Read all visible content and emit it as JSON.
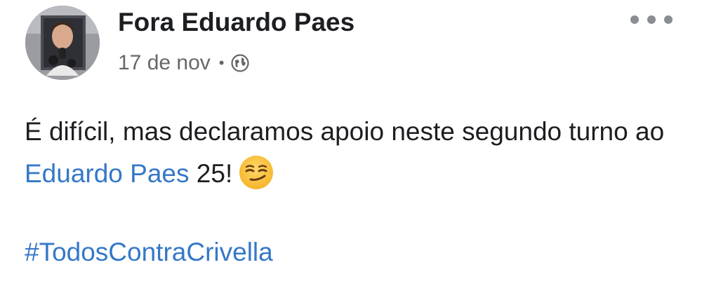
{
  "post": {
    "author": "Fora Eduardo Paes",
    "date": "17 de nov",
    "separator": "•",
    "privacy_icon": "globe-icon",
    "menu_icon": "more-options-icon",
    "text": {
      "part1": "É difícil, mas declaramos apoio neste segundo turno ao ",
      "mention": "Eduardo Paes",
      "part2": " 25!",
      "emoji": "smirking-face-emoji"
    },
    "hashtag": "#TodosContraCrivella"
  },
  "colors": {
    "link": "#3578c8",
    "text": "#1c1e21",
    "meta": "#65676b"
  }
}
